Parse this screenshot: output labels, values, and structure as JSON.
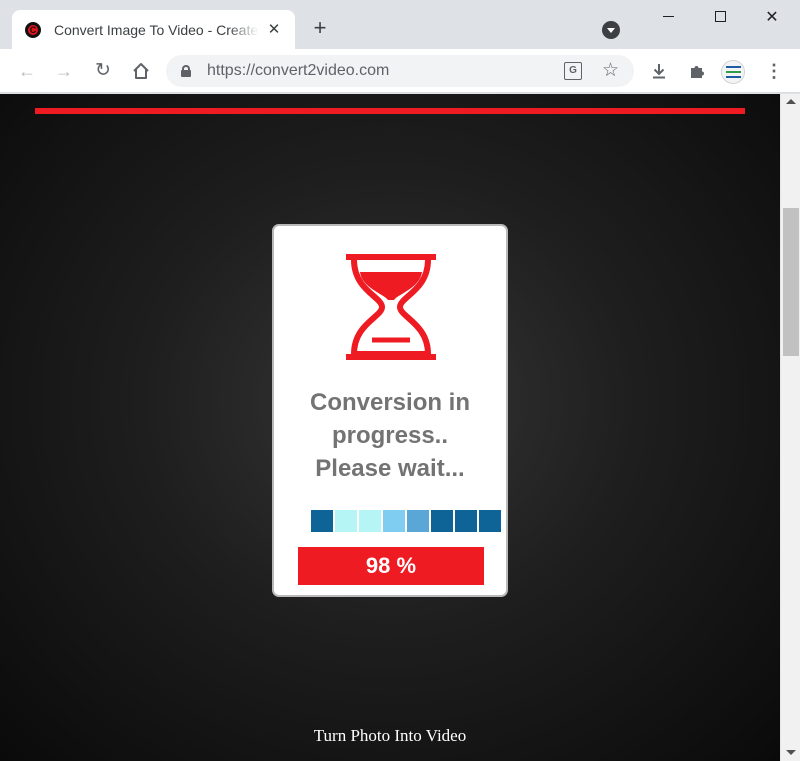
{
  "browser": {
    "tab": {
      "title": "Convert Image To Video - Create Video From Photos",
      "favicon_letter": "C"
    },
    "new_tab_label": "+",
    "close_label": "✕",
    "address_bar": {
      "url": "https://convert2video.com"
    },
    "icons": [
      "back-arrow",
      "forward-arrow",
      "reload",
      "home",
      "lock",
      "translate",
      "star",
      "download",
      "extensions",
      "profile",
      "menu"
    ]
  },
  "page": {
    "status_lines": [
      "Conversion in",
      "progress..",
      "Please wait..."
    ],
    "progress": {
      "percent_label": "98 %",
      "value": 0.98
    },
    "segments": [
      "#0e6496",
      "#b6f5f5",
      "#b6f5f5",
      "#7fcdf0",
      "#5aa6d6",
      "#0e6496",
      "#0e6496",
      "#0e6496"
    ],
    "footer_text": "Turn Photo Into Video"
  },
  "colors": {
    "accent_red": "#ee1b22",
    "status_text": "#737373",
    "card_bg": "#ffffff"
  }
}
